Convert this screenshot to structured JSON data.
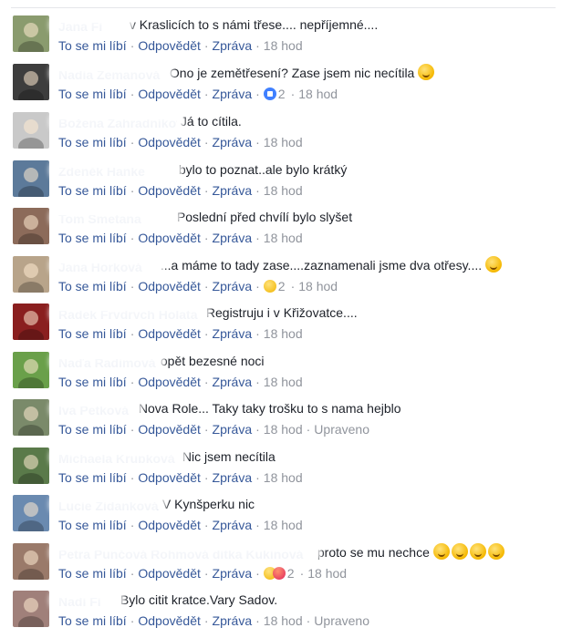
{
  "actions": {
    "like": "To se mi líbí",
    "reply": "Odpovědět",
    "message": "Zpráva",
    "separator": "·",
    "edited": "Upraveno"
  },
  "comments": [
    {
      "author": "Jana Fi",
      "text": "v Kraslicích to s námi třese.... nepříjemné....",
      "time": "18 hod",
      "reactions": "",
      "count": "",
      "edited": ""
    },
    {
      "author": "Nadia Zemanová",
      "text": "Ono je zemětřesení? Zase jsem nic necítila",
      "emoji": "wink",
      "time": "18 hod",
      "reactions": "like",
      "count": "2",
      "edited": ""
    },
    {
      "author": "Božena Zahradníková",
      "text": "Já to cítila.",
      "time": "18 hod",
      "reactions": "",
      "count": "",
      "edited": ""
    },
    {
      "author": "Zdeněk Hanke",
      "text": "bylo to poznat..ale bylo krátký",
      "time": "18 hod",
      "reactions": "",
      "count": "",
      "edited": ""
    },
    {
      "author": "Tom Smetana",
      "text": "Poslední před chvílí bylo slyšet",
      "time": "18 hod",
      "reactions": "",
      "count": "",
      "edited": ""
    },
    {
      "author": "Jana Horková",
      "text": "...a máme to tady zase....zaznamenali jsme dva otřesy....",
      "emoji": "smile",
      "time": "18 hod",
      "reactions": "sad",
      "count": "2",
      "edited": ""
    },
    {
      "author": "Radek Frydrych Holata",
      "text": "Registruju i v Křižovatce....",
      "time": "18 hod",
      "reactions": "",
      "count": "",
      "edited": ""
    },
    {
      "author": "Naďa Radimová",
      "text": "opět bezesné noci",
      "time": "18 hod",
      "reactions": "",
      "count": "",
      "edited": ""
    },
    {
      "author": "Iva Petková",
      "text": "Nova Role... Taky taky trošku to s nama hejblo",
      "time": "18 hod",
      "reactions": "",
      "count": "",
      "edited": "Upraveno"
    },
    {
      "author": "Michaela Krupková",
      "text": "Nic jsem necítila",
      "time": "18 hod",
      "reactions": "",
      "count": "",
      "edited": ""
    },
    {
      "author": "Lucie Židanková",
      "text": "V Kynšperku nic",
      "time": "18 hod",
      "reactions": "",
      "count": "",
      "edited": ""
    },
    {
      "author": "Petra Punčová Rohmová ditka Kukinová",
      "text": "proto se mu nechce",
      "emoji": "laugh4",
      "time": "18 hod",
      "reactions": "wow-angry",
      "count": "2",
      "edited": ""
    },
    {
      "author": "Nadi Fi",
      "text": "Bylo citit kratce.Vary Sadov.",
      "time": "18 hod",
      "reactions": "",
      "count": "",
      "edited": "Upraveno"
    }
  ],
  "avatar_colors": [
    "#8a9b6e",
    "#3d3d3d",
    "#c9c9c9",
    "#5c7a9a",
    "#8c6b5a",
    "#b8a48a",
    "#8a1f1f",
    "#6aa04a",
    "#7a8a6a",
    "#5a7a4a",
    "#6a8ab0",
    "#9a7a6a",
    "#a0807a"
  ]
}
